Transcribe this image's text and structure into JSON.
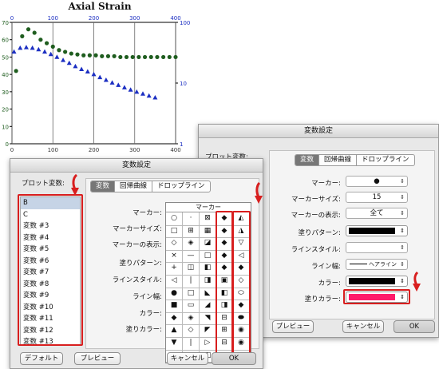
{
  "chart_data": {
    "type": "scatter",
    "title": "Axial Strain",
    "xlim": [
      0,
      400
    ],
    "ylim_left": [
      0,
      70
    ],
    "ylim_right": [
      1,
      100
    ],
    "right_axis_scale": "log",
    "x_ticks": [
      "0",
      "100",
      "200",
      "300",
      "400"
    ],
    "x_top_ticks": [
      "0",
      "100",
      "200",
      "300",
      "400"
    ],
    "y_left_ticks": [
      "0",
      "10",
      "20",
      "30",
      "40",
      "50",
      "60",
      "70"
    ],
    "y_right_ticks": [
      "1",
      "10",
      "100"
    ],
    "grid": "vertical",
    "series": [
      {
        "marker": "circle",
        "color": "#1f5d1f",
        "axis": "left",
        "x": [
          10,
          25,
          40,
          55,
          70,
          85,
          100,
          115,
          130,
          145,
          160,
          175,
          190,
          205,
          220,
          235,
          250,
          265,
          280,
          295,
          310,
          325,
          340,
          355,
          370,
          385,
          400
        ],
        "y": [
          42,
          62,
          66,
          64,
          60,
          58,
          56,
          54,
          53,
          52,
          51.5,
          51,
          51,
          51,
          50.5,
          50.5,
          50.5,
          50,
          50,
          50,
          50,
          50,
          50,
          50,
          50,
          50,
          50
        ]
      },
      {
        "marker": "triangle",
        "color": "#1c2fc2",
        "axis": "right",
        "x": [
          5,
          20,
          35,
          50,
          65,
          80,
          95,
          110,
          125,
          140,
          155,
          170,
          185,
          200,
          215,
          230,
          245,
          260,
          275,
          290,
          305,
          320,
          335,
          350
        ],
        "y": [
          33,
          38,
          39,
          38,
          36,
          33,
          30,
          27,
          24,
          21.5,
          19,
          17,
          15.5,
          14,
          12.5,
          11.3,
          10.2,
          9.3,
          8.5,
          7.8,
          7.2,
          6.7,
          6.2,
          5.8
        ]
      }
    ]
  },
  "back_dialog": {
    "title": "変数設定",
    "side_label": "プロット変数:",
    "tabs": [
      "変数",
      "回帰曲線",
      "ドロップライン"
    ],
    "rows": [
      {
        "label": "マーカー:",
        "value": "●"
      },
      {
        "label": "マーカーサイズ:",
        "value": "15"
      },
      {
        "label": "マーカーの表示:",
        "value": "全て"
      },
      {
        "label": "塗りパターン:",
        "value": ""
      },
      {
        "label": "ラインスタイル:",
        "value": ""
      },
      {
        "label": "ライン幅:",
        "value": "ヘアライン"
      },
      {
        "label": "カラー:",
        "value": ""
      },
      {
        "label": "塗りカラー:",
        "value": ""
      }
    ],
    "colors": {
      "line_color": "#000000",
      "fill_color": "#ff1a6a",
      "pattern": "#000000"
    },
    "buttons": {
      "preview": "プレビュー",
      "cancel": "キャンセル",
      "ok": "OK"
    }
  },
  "front_dialog": {
    "title": "変数設定",
    "list_label": "プロット変数:",
    "variables": [
      "B",
      "C",
      "変数 #3",
      "変数 #4",
      "変数 #5",
      "変数 #6",
      "変数 #7",
      "変数 #8",
      "変数 #9",
      "変数 #10",
      "変数 #11",
      "変数 #12",
      "変数 #13"
    ],
    "tabs": [
      "変数",
      "回帰曲線",
      "ドロップライン"
    ],
    "rows": [
      "マーカー:",
      "マーカーサイズ:",
      "マーカーの表示:",
      "塗りパターン:",
      "ラインスタイル:",
      "ライン幅:",
      "カラー:",
      "塗りカラー:"
    ],
    "palette_title": "マーカー",
    "markers": [
      [
        "○",
        "·",
        "⊠",
        "◆",
        "◭"
      ],
      [
        "□",
        "⊞",
        "▦",
        "◆",
        "◮"
      ],
      [
        "◇",
        "◈",
        "◪",
        "◆",
        "▽"
      ],
      [
        "×",
        "—",
        "□",
        "◆",
        "◁"
      ],
      [
        "+",
        "◫",
        "◧",
        "◆",
        "◆"
      ],
      [
        "◁",
        "|",
        "◨",
        "▣",
        "◇"
      ],
      [
        "●",
        "□",
        "◣",
        "◧",
        "⬭"
      ],
      [
        "■",
        "▭",
        "◢",
        "◨",
        "◆"
      ],
      [
        "◆",
        "◈",
        "◥",
        "⊟",
        "⬬"
      ],
      [
        "▲",
        "◇",
        "◤",
        "⊞",
        "◉"
      ],
      [
        "▼",
        "|",
        "▷",
        "⊟",
        "◉"
      ],
      [
        "○",
        "⊠",
        "◧",
        "◭",
        "◆"
      ]
    ],
    "buttons": {
      "default": "デフォルト",
      "preview": "プレビュー",
      "cancel": "キャンセル",
      "ok": "OK"
    }
  }
}
